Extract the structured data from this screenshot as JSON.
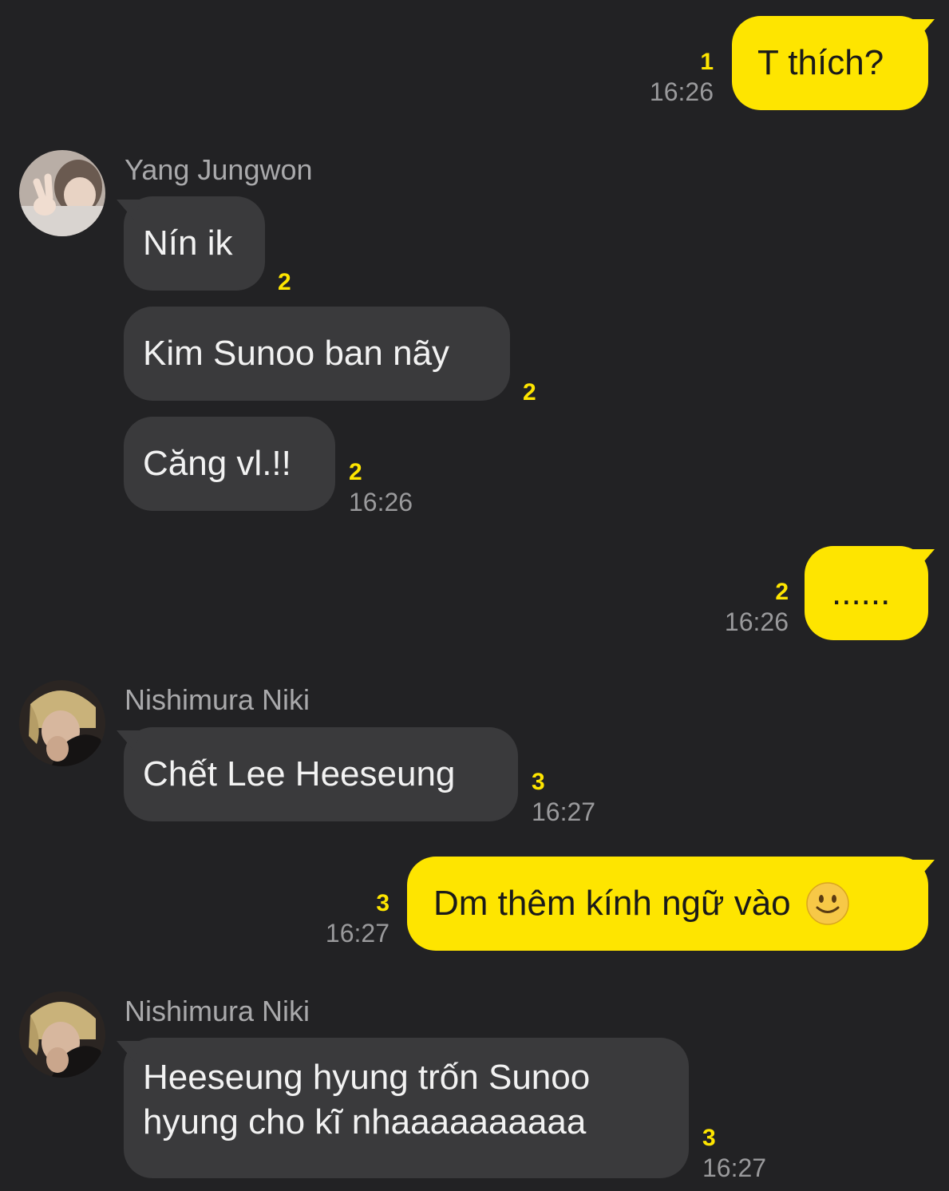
{
  "messages": [
    {
      "text": "T thích?",
      "unread": "1",
      "time": "16:26"
    },
    {
      "sender": "Yang Jungwon"
    },
    {
      "text": "Nín ik",
      "unread": "2"
    },
    {
      "text": "Kim Sunoo ban nãy",
      "unread": "2"
    },
    {
      "text": "Căng vl.!!",
      "unread": "2",
      "time": "16:26"
    },
    {
      "text": "......",
      "unread": "2",
      "time": "16:26"
    },
    {
      "sender": "Nishimura Niki"
    },
    {
      "text": "Chết Lee Heeseung",
      "unread": "3",
      "time": "16:27"
    },
    {
      "text": "Dm thêm kính ngữ vào",
      "emoji": "🙂",
      "unread": "3",
      "time": "16:27"
    },
    {
      "sender": "Nishimura Niki"
    },
    {
      "text": "Heeseung hyung trốn Sunoo hyung cho kĩ nhaaaaaaaaaa",
      "unread": "3",
      "time": "16:27"
    }
  ],
  "colors": {
    "background": "#222224",
    "outgoing_bubble": "#fee500",
    "incoming_bubble": "#3a3a3c",
    "unread_count": "#fee500",
    "timestamp": "#9a9a9c"
  }
}
